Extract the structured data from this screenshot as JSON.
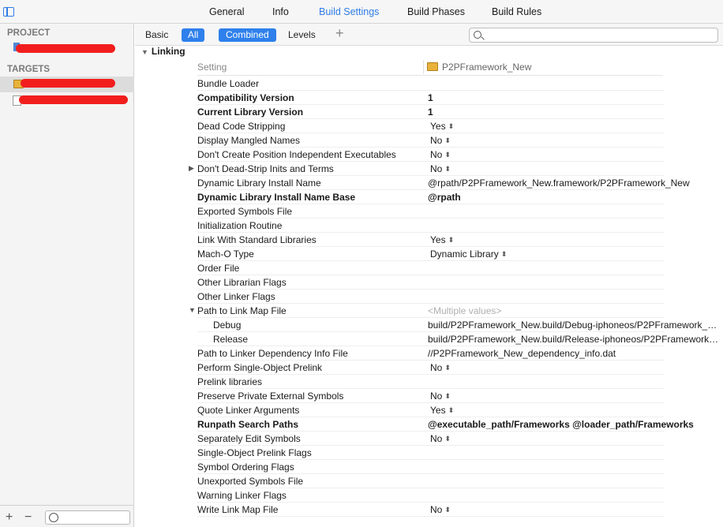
{
  "tabs": [
    "General",
    "Info",
    "Build Settings",
    "Build Phases",
    "Build Rules"
  ],
  "active_tab": "Build Settings",
  "sidebar": {
    "project_header": "PROJECT",
    "targets_header": "TARGETS"
  },
  "filterbar": {
    "basic": "Basic",
    "all": "All",
    "combined": "Combined",
    "levels": "Levels",
    "add": "+"
  },
  "colors": {
    "accent": "#2f80ec",
    "redaction": "#f21e1e",
    "selection": "#dcdcdc"
  },
  "section": "Linking",
  "columns": {
    "setting": "Setting",
    "target": "P2PFramework_New"
  },
  "rows": [
    {
      "name": "Bundle Loader",
      "value": ""
    },
    {
      "name": "Compatibility Version",
      "value": "1",
      "bold": true
    },
    {
      "name": "Current Library Version",
      "value": "1",
      "bold": true
    },
    {
      "name": "Dead Code Stripping",
      "value": "Yes",
      "popup": true
    },
    {
      "name": "Display Mangled Names",
      "value": "No",
      "popup": true
    },
    {
      "name": "Don't Create Position Independent Executables",
      "value": "No",
      "popup": true
    },
    {
      "name": "Don't Dead-Strip Inits and Terms",
      "value": "No",
      "popup": true,
      "collapsed": true
    },
    {
      "name": "Dynamic Library Install Name",
      "value": "@rpath/P2PFramework_New.framework/P2PFramework_New"
    },
    {
      "name": "Dynamic Library Install Name Base",
      "value": "@rpath",
      "bold": true
    },
    {
      "name": "Exported Symbols File",
      "value": ""
    },
    {
      "name": "Initialization Routine",
      "value": ""
    },
    {
      "name": "Link With Standard Libraries",
      "value": "Yes",
      "popup": true
    },
    {
      "name": "Mach-O Type",
      "value": "Dynamic Library",
      "popup": true
    },
    {
      "name": "Order File",
      "value": ""
    },
    {
      "name": "Other Librarian Flags",
      "value": ""
    },
    {
      "name": "Other Linker Flags",
      "value": ""
    },
    {
      "name": "Path to Link Map File",
      "value": "<Multiple values>",
      "placeholder": true,
      "expanded": true
    },
    {
      "name": "Debug",
      "value": "build/P2PFramework_New.build/Debug-iphoneos/P2PFramework_N...",
      "sub": true
    },
    {
      "name": "Release",
      "value": "build/P2PFramework_New.build/Release-iphoneos/P2PFramework_...",
      "sub": true
    },
    {
      "name": "Path to Linker Dependency Info File",
      "value": "//P2PFramework_New_dependency_info.dat"
    },
    {
      "name": "Perform Single-Object Prelink",
      "value": "No",
      "popup": true
    },
    {
      "name": "Prelink libraries",
      "value": ""
    },
    {
      "name": "Preserve Private External Symbols",
      "value": "No",
      "popup": true
    },
    {
      "name": "Quote Linker Arguments",
      "value": "Yes",
      "popup": true
    },
    {
      "name": "Runpath Search Paths",
      "value": "@executable_path/Frameworks @loader_path/Frameworks",
      "bold": true
    },
    {
      "name": "Separately Edit Symbols",
      "value": "No",
      "popup": true
    },
    {
      "name": "Single-Object Prelink Flags",
      "value": ""
    },
    {
      "name": "Symbol Ordering Flags",
      "value": ""
    },
    {
      "name": "Unexported Symbols File",
      "value": ""
    },
    {
      "name": "Warning Linker Flags",
      "value": ""
    },
    {
      "name": "Write Link Map File",
      "value": "No",
      "popup": true
    }
  ]
}
